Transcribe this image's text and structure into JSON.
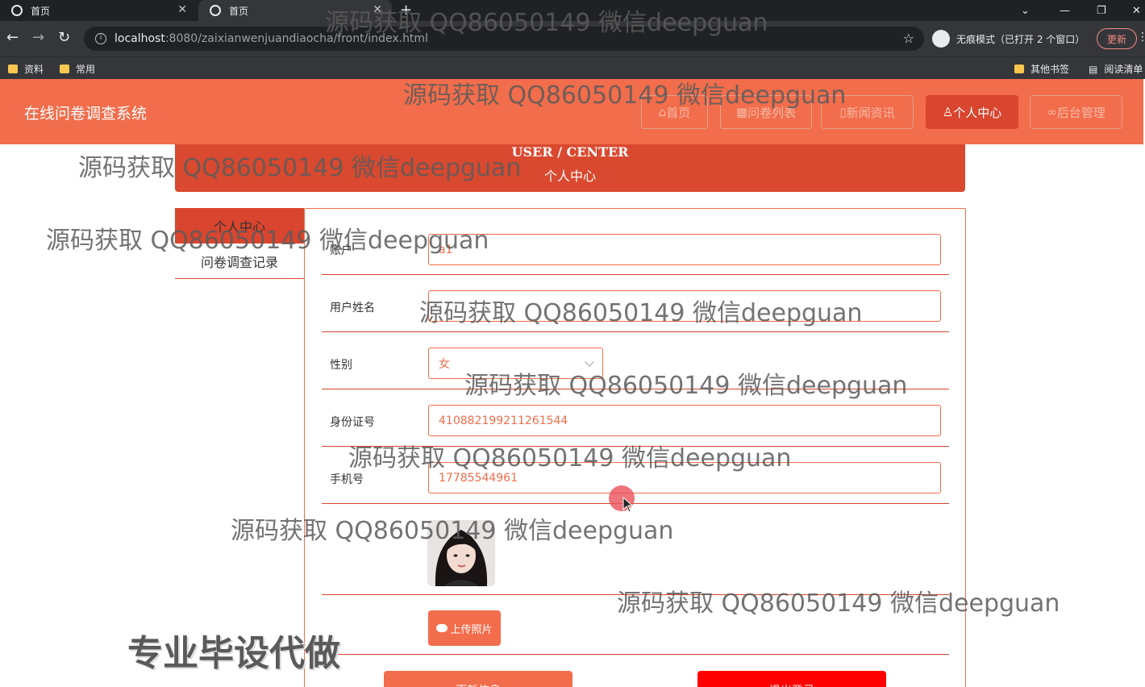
{
  "browser": {
    "tabs": [
      {
        "title": "首页",
        "active": false
      },
      {
        "title": "首页",
        "active": true
      }
    ],
    "url_host": "localhost",
    "url_path": ":8080/zaixianwenjuandiaocha/front/index.html",
    "incognito_label": "无痕模式（已打开 2 个窗口）",
    "update_label": "更新",
    "bookmarks_left": [
      "资料",
      "常用"
    ],
    "bookmarks_right": [
      "其他书签",
      "阅读清单"
    ]
  },
  "site": {
    "title": "在线问卷调查系统",
    "nav": [
      {
        "label": "首页",
        "icon": "home-icon",
        "active": false
      },
      {
        "label": "问卷列表",
        "icon": "grid-icon",
        "active": false
      },
      {
        "label": "新闻资讯",
        "icon": "doc-icon",
        "active": false
      },
      {
        "label": "个人中心",
        "icon": "user-icon",
        "active": true
      },
      {
        "label": "后台管理",
        "icon": "link-icon",
        "active": false
      }
    ],
    "accent_color": "#f26d4b",
    "dark_accent_color": "#d9452e"
  },
  "banner": {
    "en": "USER / CENTER",
    "cn": "个人中心"
  },
  "sidebar": {
    "items": [
      {
        "label": "个人中心",
        "active": true
      },
      {
        "label": "问卷调查记录",
        "active": false
      }
    ]
  },
  "form": {
    "fields": [
      {
        "label": "账户",
        "value": "a1"
      },
      {
        "label": "用户姓名",
        "value": ""
      },
      {
        "label": "性别",
        "value": "女"
      },
      {
        "label": "身份证号",
        "value": "410882199211261544"
      },
      {
        "label": "手机号",
        "value": "17785544961"
      }
    ],
    "upload_label": "上传照片",
    "update_button": "更新信息",
    "logout_button": "退出登录"
  },
  "watermarks": [
    "源码获取 QQ86050149 微信deepguan"
  ],
  "promo_text": "专业毕设代做"
}
